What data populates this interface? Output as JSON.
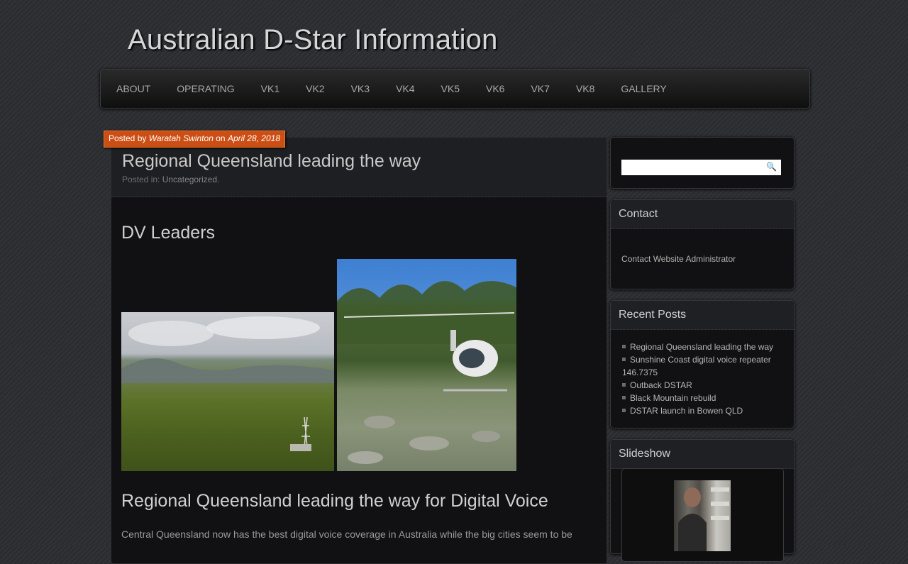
{
  "site": {
    "title": "Australian D-Star Information"
  },
  "nav": {
    "items": [
      "ABOUT",
      "OPERATING",
      "VK1",
      "VK2",
      "VK3",
      "VK4",
      "VK5",
      "VK6",
      "VK7",
      "VK8",
      "GALLERY"
    ]
  },
  "post": {
    "byline_prefix": "Posted by",
    "author": "Waratah Swinton",
    "byline_on": "on",
    "date": "April 28, 2018",
    "title": "Regional Queensland leading the way",
    "category_prefix": "Posted in:",
    "category": "Uncategorized",
    "heading1": "DV Leaders",
    "heading2": "Regional Queensland leading the way for Digital Voice",
    "paragraph": "Central Queensland now has the best digital voice coverage in Australia while the big cities seem to be"
  },
  "sidebar": {
    "contact": {
      "title": "Contact",
      "link": "Contact Website Administrator"
    },
    "recent": {
      "title": "Recent Posts",
      "items": [
        "Regional Queensland leading the way",
        "Sunshine Coast digital voice repeater 146.7375",
        "Outback DSTAR",
        "Black Mountain rebuild",
        "DSTAR launch in Bowen QLD"
      ]
    },
    "slideshow": {
      "title": "Slideshow"
    }
  },
  "colors": {
    "byline_bg": "#cc4e14",
    "background": "#2b2c30"
  }
}
